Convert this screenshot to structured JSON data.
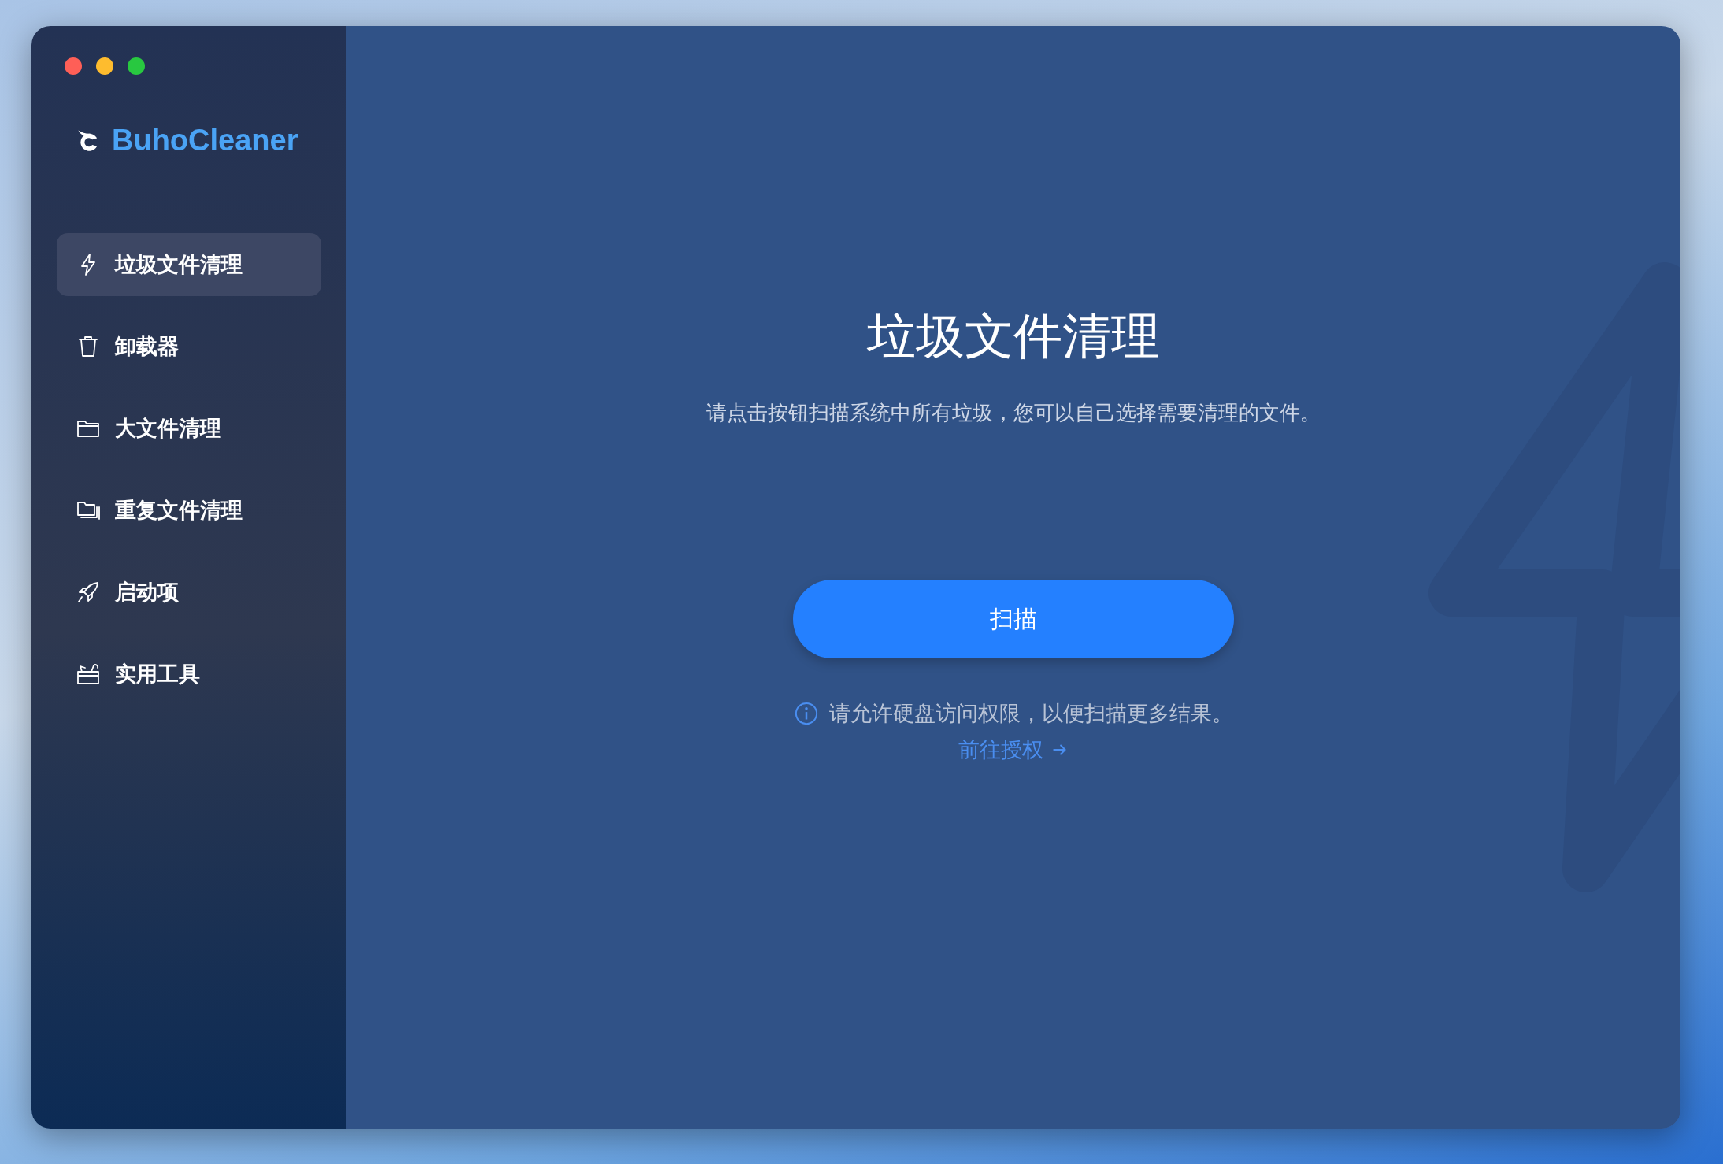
{
  "app": {
    "name": "BuhoCleaner"
  },
  "sidebar": {
    "items": [
      {
        "label": "垃圾文件清理",
        "selected": true
      },
      {
        "label": "卸载器",
        "selected": false
      },
      {
        "label": "大文件清理",
        "selected": false
      },
      {
        "label": "重复文件清理",
        "selected": false
      },
      {
        "label": "启动项",
        "selected": false
      },
      {
        "label": "实用工具",
        "selected": false
      }
    ]
  },
  "main": {
    "title": "垃圾文件清理",
    "description": "请点击按钮扫描系统中所有垃圾，您可以自己选择需要清理的文件。",
    "scan_button": "扫描",
    "notice": "请允许硬盘访问权限，以便扫描更多结果。",
    "link": "前往授权"
  }
}
